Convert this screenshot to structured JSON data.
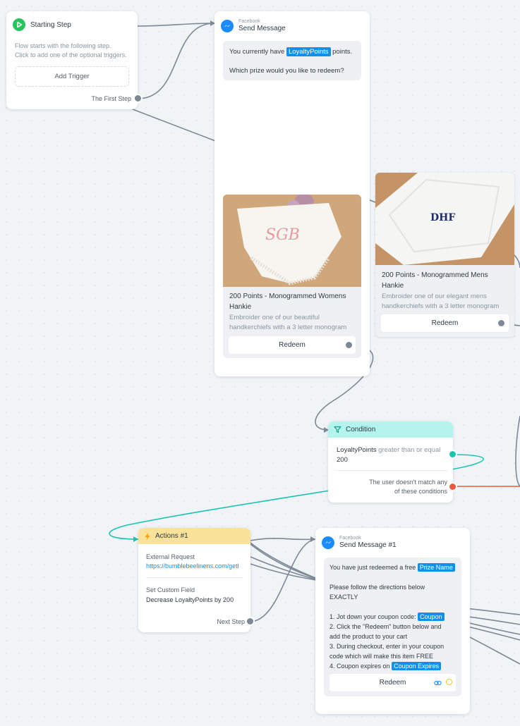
{
  "start_step": {
    "title": "Starting Step",
    "description_line1": "Flow starts with the following step.",
    "description_line2": "Click to add one of the optional triggers.",
    "add_trigger_label": "Add Trigger",
    "output_label": "The First Step"
  },
  "send_message": {
    "platform": "Facebook",
    "title": "Send Message",
    "text_before": "You currently have",
    "field_tag": "LoyaltyPoints",
    "text_after": "points.",
    "question": "Which prize would you like to redeem?",
    "cards": [
      {
        "image_monogram": "SGB",
        "title_line1": "200 Points - Monogrammed Womens",
        "title_line2": "Hankie",
        "subtitle_line1": "Embroider one of our beautiful",
        "subtitle_line2": "handkerchiefs with a 3 letter monogram",
        "button_label": "Redeem"
      },
      {
        "image_monogram": "DHF",
        "title_line1": "200 Points - Monogrammed Mens",
        "title_line2": "Hankie",
        "subtitle_line1": "Embroider one of our elegant mens",
        "subtitle_line2": "handkerchiefs with a 3 letter monogram",
        "button_label": "Redeem"
      }
    ]
  },
  "condition": {
    "title": "Condition",
    "field": "LoyaltyPoints",
    "operator": "greater than or equal",
    "value": "200",
    "fallback_line1": "The user doesn't match any",
    "fallback_line2": "of these conditions"
  },
  "actions": {
    "title": "Actions #1",
    "items": [
      {
        "label": "External Request",
        "value": "https://bumblebeelinens.com/getl"
      },
      {
        "label": "Set Custom Field",
        "value": "Decrease LoyaltyPoints by 200"
      }
    ],
    "output_label": "Next Step"
  },
  "send_message_1": {
    "platform": "Facebook",
    "title": "Send Message #1",
    "line1": "You have just redeemed a free",
    "prize_tag": "Prize Name",
    "line2": "Please follow the directions below",
    "line3": "EXACTLY",
    "step1": "1. Jot down your coupon code:",
    "coupon_tag": "Coupon",
    "step2a": "2. Click the \"Redeem\" button below and",
    "step2b": "add the product to your cart",
    "step3a": "3. During checkout, enter in your coupon",
    "step3b": "code which will make this item FREE",
    "step4": "4. Coupon expires on",
    "expires_tag": "Coupon Expires",
    "button_label": "Redeem"
  },
  "colors": {
    "messenger": "#1a8cff",
    "start": "#25c55e",
    "condition_header": "#b3f4ee",
    "actions_header": "#fbe29b",
    "tag": "#1390e6",
    "port_true": "#19c4b1",
    "port_false": "#ea5a3f",
    "wire": "#7d8896"
  }
}
